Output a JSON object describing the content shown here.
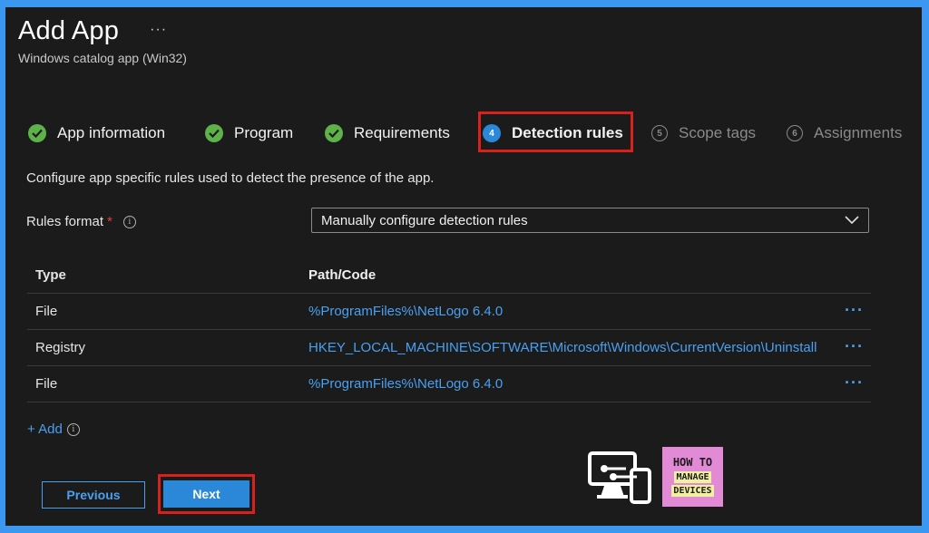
{
  "header": {
    "title": "Add App",
    "subtitle": "Windows catalog app (Win32)",
    "more_label": "···"
  },
  "steps": [
    {
      "label": "App information",
      "state": "done"
    },
    {
      "label": "Program",
      "state": "done"
    },
    {
      "label": "Requirements",
      "state": "done"
    },
    {
      "number": "4",
      "label": "Detection rules",
      "state": "active"
    },
    {
      "number": "5",
      "label": "Scope tags",
      "state": "pending"
    },
    {
      "number": "6",
      "label": "Assignments",
      "state": "pending"
    }
  ],
  "content": {
    "description": "Configure app specific rules used to detect the presence of the app.",
    "rules_format_label": "Rules format",
    "required_mark": "*",
    "info_glyph": "i",
    "rules_format_value": "Manually configure detection rules"
  },
  "table": {
    "headers": {
      "type": "Type",
      "path": "Path/Code"
    },
    "rows": [
      {
        "type": "File",
        "path": "%ProgramFiles%\\NetLogo 6.4.0"
      },
      {
        "type": "Registry",
        "path": "HKEY_LOCAL_MACHINE\\SOFTWARE\\Microsoft\\Windows\\CurrentVersion\\Uninstall"
      },
      {
        "type": "File",
        "path": "%ProgramFiles%\\NetLogo 6.4.0"
      }
    ],
    "row_more_label": "···"
  },
  "add_label": "+ Add",
  "footer": {
    "previous_label": "Previous",
    "next_label": "Next"
  },
  "watermark": {
    "line1": "HOW TO",
    "line2": "MANAGE",
    "line3": "DEVICES"
  },
  "colors": {
    "accent": "#2b88d8",
    "link": "#4aa0f0",
    "success": "#5eb24a",
    "highlight": "#d8201c",
    "background": "#1b1b1b",
    "border_frame": "#3b97f0"
  },
  "icons": {
    "step_done": "checkmark-circle-icon",
    "dropdown": "chevron-down-icon",
    "info": "info-icon",
    "more": "ellipsis-icon"
  }
}
